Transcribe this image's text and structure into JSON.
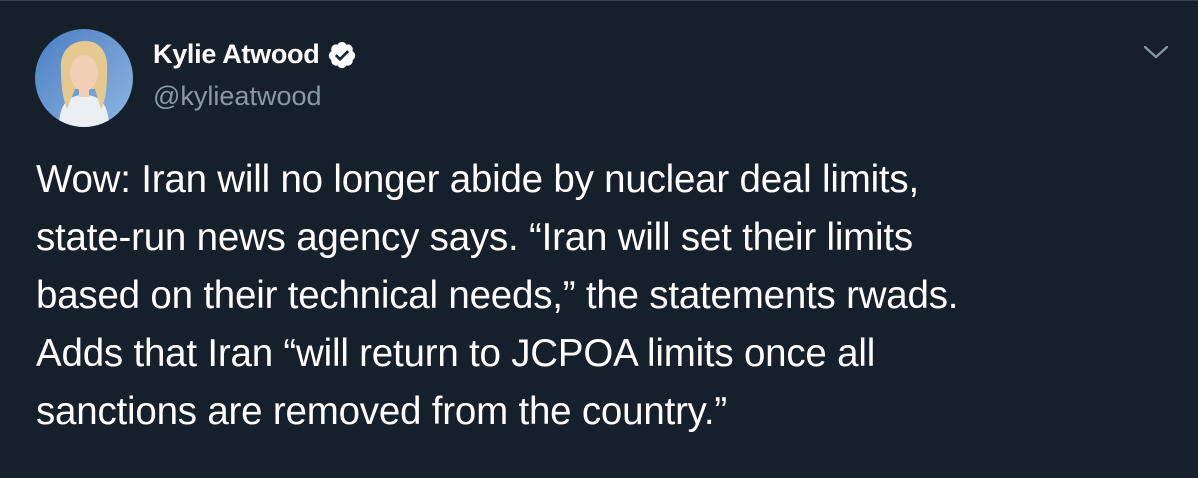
{
  "tweet": {
    "author": {
      "display_name": "Kylie Atwood",
      "handle": "@kylieatwood",
      "verified": true,
      "verified_icon": "verified-badge-icon"
    },
    "menu_icon": "chevron-down-icon",
    "text_lines": [
      "Wow: Iran will no longer abide by nuclear deal limits,",
      "state-run news agency says. “Iran will set their limits",
      "based on their technical needs,” the statements rwads.",
      "Adds that Iran “will return to JCPOA limits once all",
      "sanctions are removed from the country.”"
    ]
  },
  "colors": {
    "background": "#15202b",
    "primary_text": "#ffffff",
    "secondary_text": "#8899a6",
    "border": "#38444d"
  }
}
